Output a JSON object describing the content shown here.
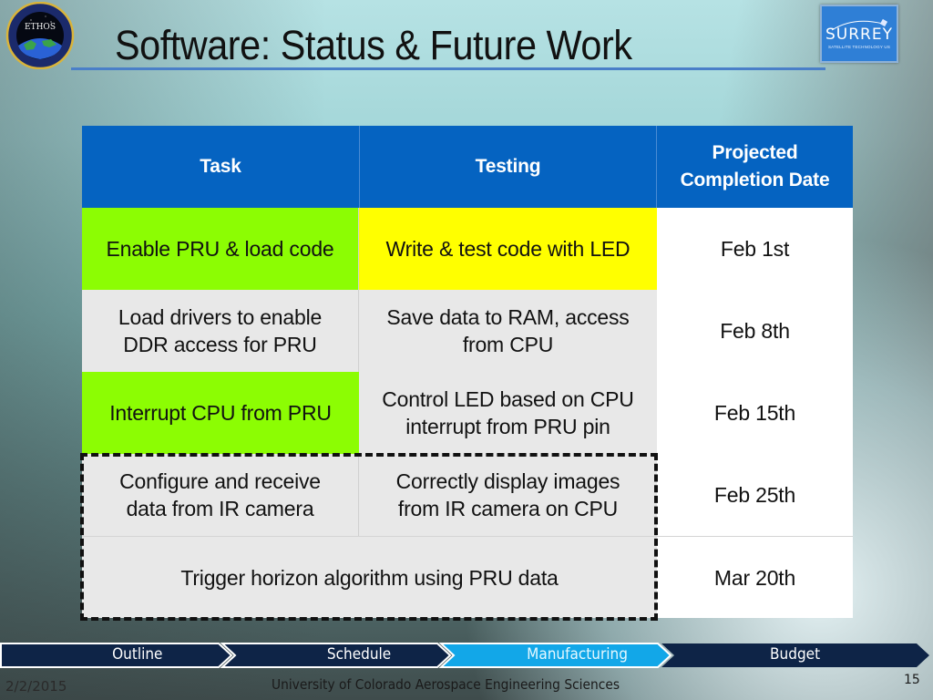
{
  "slide": {
    "title": "Software: Status & Future Work",
    "logos": {
      "left": {
        "name": "ETHOS",
        "ring_text": "ETHOS"
      },
      "right": {
        "name": "SURREY",
        "subtitle": "SATELLITE TECHNOLOGY US"
      }
    },
    "colors": {
      "header_blue": "#0563c1",
      "complete_green": "#8cfd03",
      "in_progress_yellow": "#ffff00",
      "pending_gray": "#e8e8e8",
      "nav_dark": "#0e2447",
      "nav_active": "#12a7e8"
    }
  },
  "table": {
    "headers": [
      "Task",
      "Testing",
      "Projected Completion Date"
    ],
    "header_lines": {
      "date": [
        "Projected",
        "Completion Date"
      ]
    },
    "rows": [
      {
        "task": [
          "Enable PRU & load code"
        ],
        "testing": [
          "Write & test code with LED"
        ],
        "date": "Feb 1st",
        "task_status": "complete",
        "testing_status": "in-progress"
      },
      {
        "task": [
          "Load drivers to enable",
          "DDR access for PRU"
        ],
        "testing": [
          "Save data to RAM, access",
          "from CPU"
        ],
        "date": "Feb 8th",
        "task_status": "pending",
        "testing_status": "pending"
      },
      {
        "task": [
          "Interrupt CPU from PRU"
        ],
        "testing": [
          "Control LED based on CPU",
          "interrupt from PRU pin"
        ],
        "date": "Feb 15th",
        "task_status": "complete",
        "testing_status": "pending"
      },
      {
        "task": [
          "Configure and receive",
          "data from IR camera"
        ],
        "testing": [
          "Correctly display images",
          "from IR camera on CPU"
        ],
        "date": "Feb 25th",
        "task_status": "pending",
        "testing_status": "pending"
      },
      {
        "task": [
          "Trigger horizon algorithm using PRU data"
        ],
        "testing": [],
        "date": "Mar 20th",
        "task_status": "pending",
        "merged": true
      }
    ]
  },
  "nav": {
    "items": [
      {
        "label": "Outline",
        "active": false
      },
      {
        "label": "Schedule",
        "active": false
      },
      {
        "label": "Manufacturing",
        "active": true
      },
      {
        "label": "Budget",
        "active": false
      }
    ]
  },
  "footer": {
    "date": "2/2/2015",
    "organization": "University of Colorado Aerospace Engineering Sciences",
    "page_number": "15"
  }
}
